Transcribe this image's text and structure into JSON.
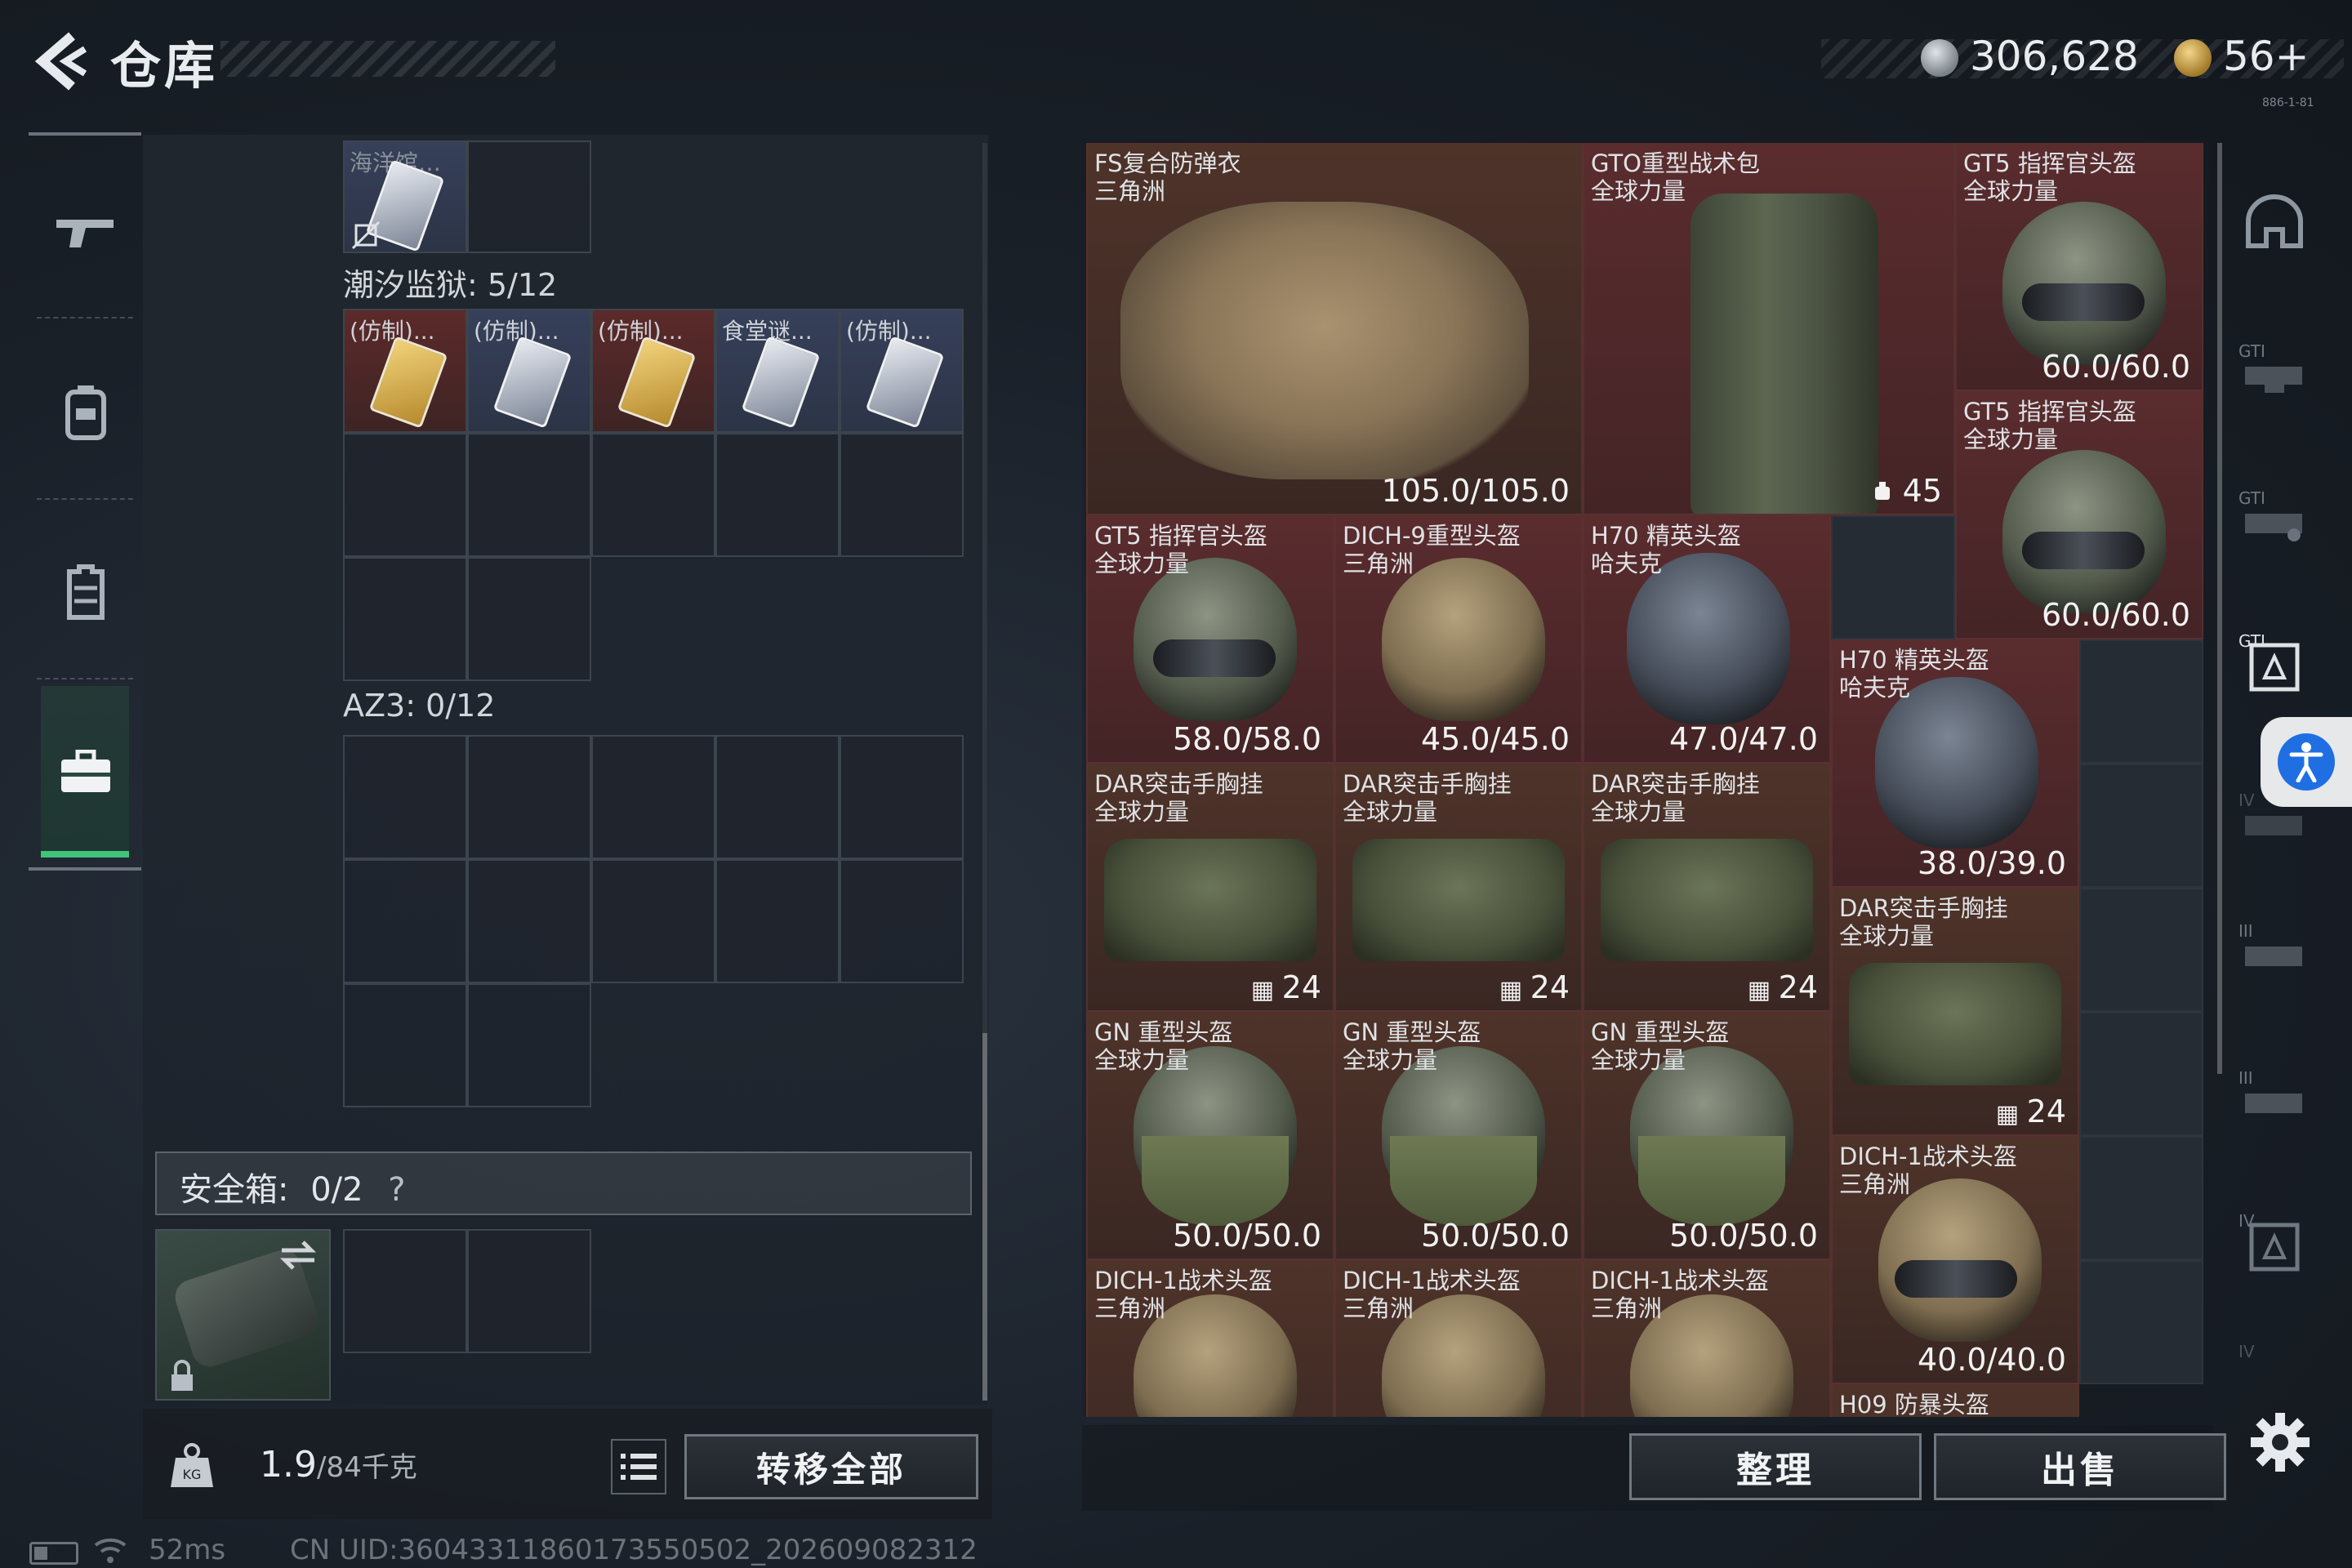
{
  "header": {
    "title": "仓库",
    "currency_silver": "306,628",
    "currency_gold": "56+",
    "tiny_label": "886-1-81"
  },
  "left_rail": {
    "icons": [
      "gun-icon",
      "backpack-icon",
      "vest-icon",
      "toolbox-icon"
    ]
  },
  "left_panel": {
    "top_cell_label": "海洋馆…",
    "tide_prison": {
      "label": "潮汐监狱: 5/12",
      "items": [
        {
          "label": "(仿制)...",
          "color": "red",
          "card": "gold"
        },
        {
          "label": "(仿制)...",
          "color": "blue",
          "card": "silver"
        },
        {
          "label": "(仿制)...",
          "color": "red",
          "card": "gold"
        },
        {
          "label": "食堂谜...",
          "color": "blue",
          "card": "silver"
        },
        {
          "label": "(仿制)...",
          "color": "blue",
          "card": "silver"
        }
      ]
    },
    "az3": {
      "label": "AZ3: 0/12"
    },
    "safe_box": {
      "label": "安全箱:",
      "count": "0/2",
      "help": "?"
    }
  },
  "bottom_left": {
    "weight_current": "1.9",
    "weight_max": "/84千克",
    "transfer_all": "转移全部"
  },
  "grid_items": [
    {
      "id": "fs-vest",
      "name": "FS复合防弹衣\n三角洲",
      "value": "105.0/105.0"
    },
    {
      "id": "gto-backpack",
      "name": "GTO重型战术包\n全球力量",
      "value": "45"
    },
    {
      "id": "gt5-a",
      "name": "GT5 指挥官头盔\n全球力量",
      "value": "60.0/60.0"
    },
    {
      "id": "gt5-b",
      "name": "GT5 指挥官头盔\n全球力量",
      "value": "60.0/60.0"
    },
    {
      "id": "gt5-c",
      "name": "GT5 指挥官头盔\n全球力量",
      "value": "58.0/58.0"
    },
    {
      "id": "dich9",
      "name": "DICH-9重型头盔\n三角洲",
      "value": "45.0/45.0"
    },
    {
      "id": "h70-a",
      "name": "H70 精英头盔\n哈夫克",
      "value": "47.0/47.0"
    },
    {
      "id": "h70-b",
      "name": "H70 精英头盔\n哈夫克",
      "value": "38.0/39.0"
    },
    {
      "id": "dar-a",
      "name": "DAR突击手胸挂\n全球力量",
      "value": "24"
    },
    {
      "id": "dar-b",
      "name": "DAR突击手胸挂\n全球力量",
      "value": "24"
    },
    {
      "id": "dar-c",
      "name": "DAR突击手胸挂\n全球力量",
      "value": "24"
    },
    {
      "id": "dar-d",
      "name": "DAR突击手胸挂\n全球力量",
      "value": "24"
    },
    {
      "id": "gn-a",
      "name": "GN 重型头盔\n全球力量",
      "value": "50.0/50.0"
    },
    {
      "id": "gn-b",
      "name": "GN 重型头盔\n全球力量",
      "value": "50.0/50.0"
    },
    {
      "id": "gn-c",
      "name": "GN 重型头盔\n全球力量",
      "value": "50.0/50.0"
    },
    {
      "id": "dich1-a",
      "name": "DICH-1战术头盔\n三角洲",
      "value": "40.0/40.0"
    },
    {
      "id": "dich1-b",
      "name": "DICH-1战术头盔\n三角洲",
      "value": ""
    },
    {
      "id": "dich1-c",
      "name": "DICH-1战术头盔\n三角洲",
      "value": ""
    },
    {
      "id": "dich1-d",
      "name": "DICH-1战术头盔\n三角洲",
      "value": ""
    },
    {
      "id": "h09",
      "name": "H09 防暴头盔",
      "value": ""
    }
  ],
  "right_rail": {
    "labels": [
      "",
      "GTI",
      "GTI",
      "GTI",
      "IV",
      "III",
      "III",
      "IV",
      "IV"
    ]
  },
  "bottom_right": {
    "sort": "整理",
    "sell": "出售"
  },
  "status": {
    "ping": "52ms",
    "uid": "CN UID:36043311860173550502_202609082312"
  },
  "colors": {
    "accent_green": "#3fc47a",
    "item_red": "#5a2c2e",
    "item_blue": "#36405a",
    "accessibility_blue": "#1f6fe3"
  }
}
